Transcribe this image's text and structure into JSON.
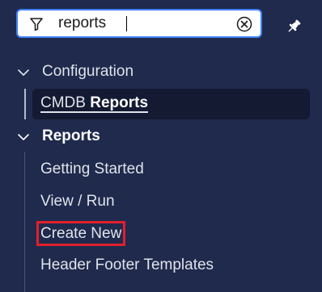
{
  "search": {
    "value": "reports"
  },
  "nav": {
    "configuration": {
      "label": "Configuration",
      "selected_item_prefix": "CMDB",
      "selected_item_match": "Reports"
    },
    "reports": {
      "label": "Reports",
      "items": [
        {
          "label": "Getting Started"
        },
        {
          "label": "View / Run"
        },
        {
          "label": "Create New"
        },
        {
          "label": "Header Footer Templates"
        }
      ]
    }
  },
  "colors": {
    "background": "#1f2a4d",
    "search_border": "#3f82f7",
    "selected_bg": "#131a31",
    "highlight_border": "#e0202c"
  },
  "icons": {
    "filter": "filter-icon",
    "clear": "clear-circle-x-icon",
    "pin": "pin-icon",
    "chevron": "chevron-down-icon"
  }
}
